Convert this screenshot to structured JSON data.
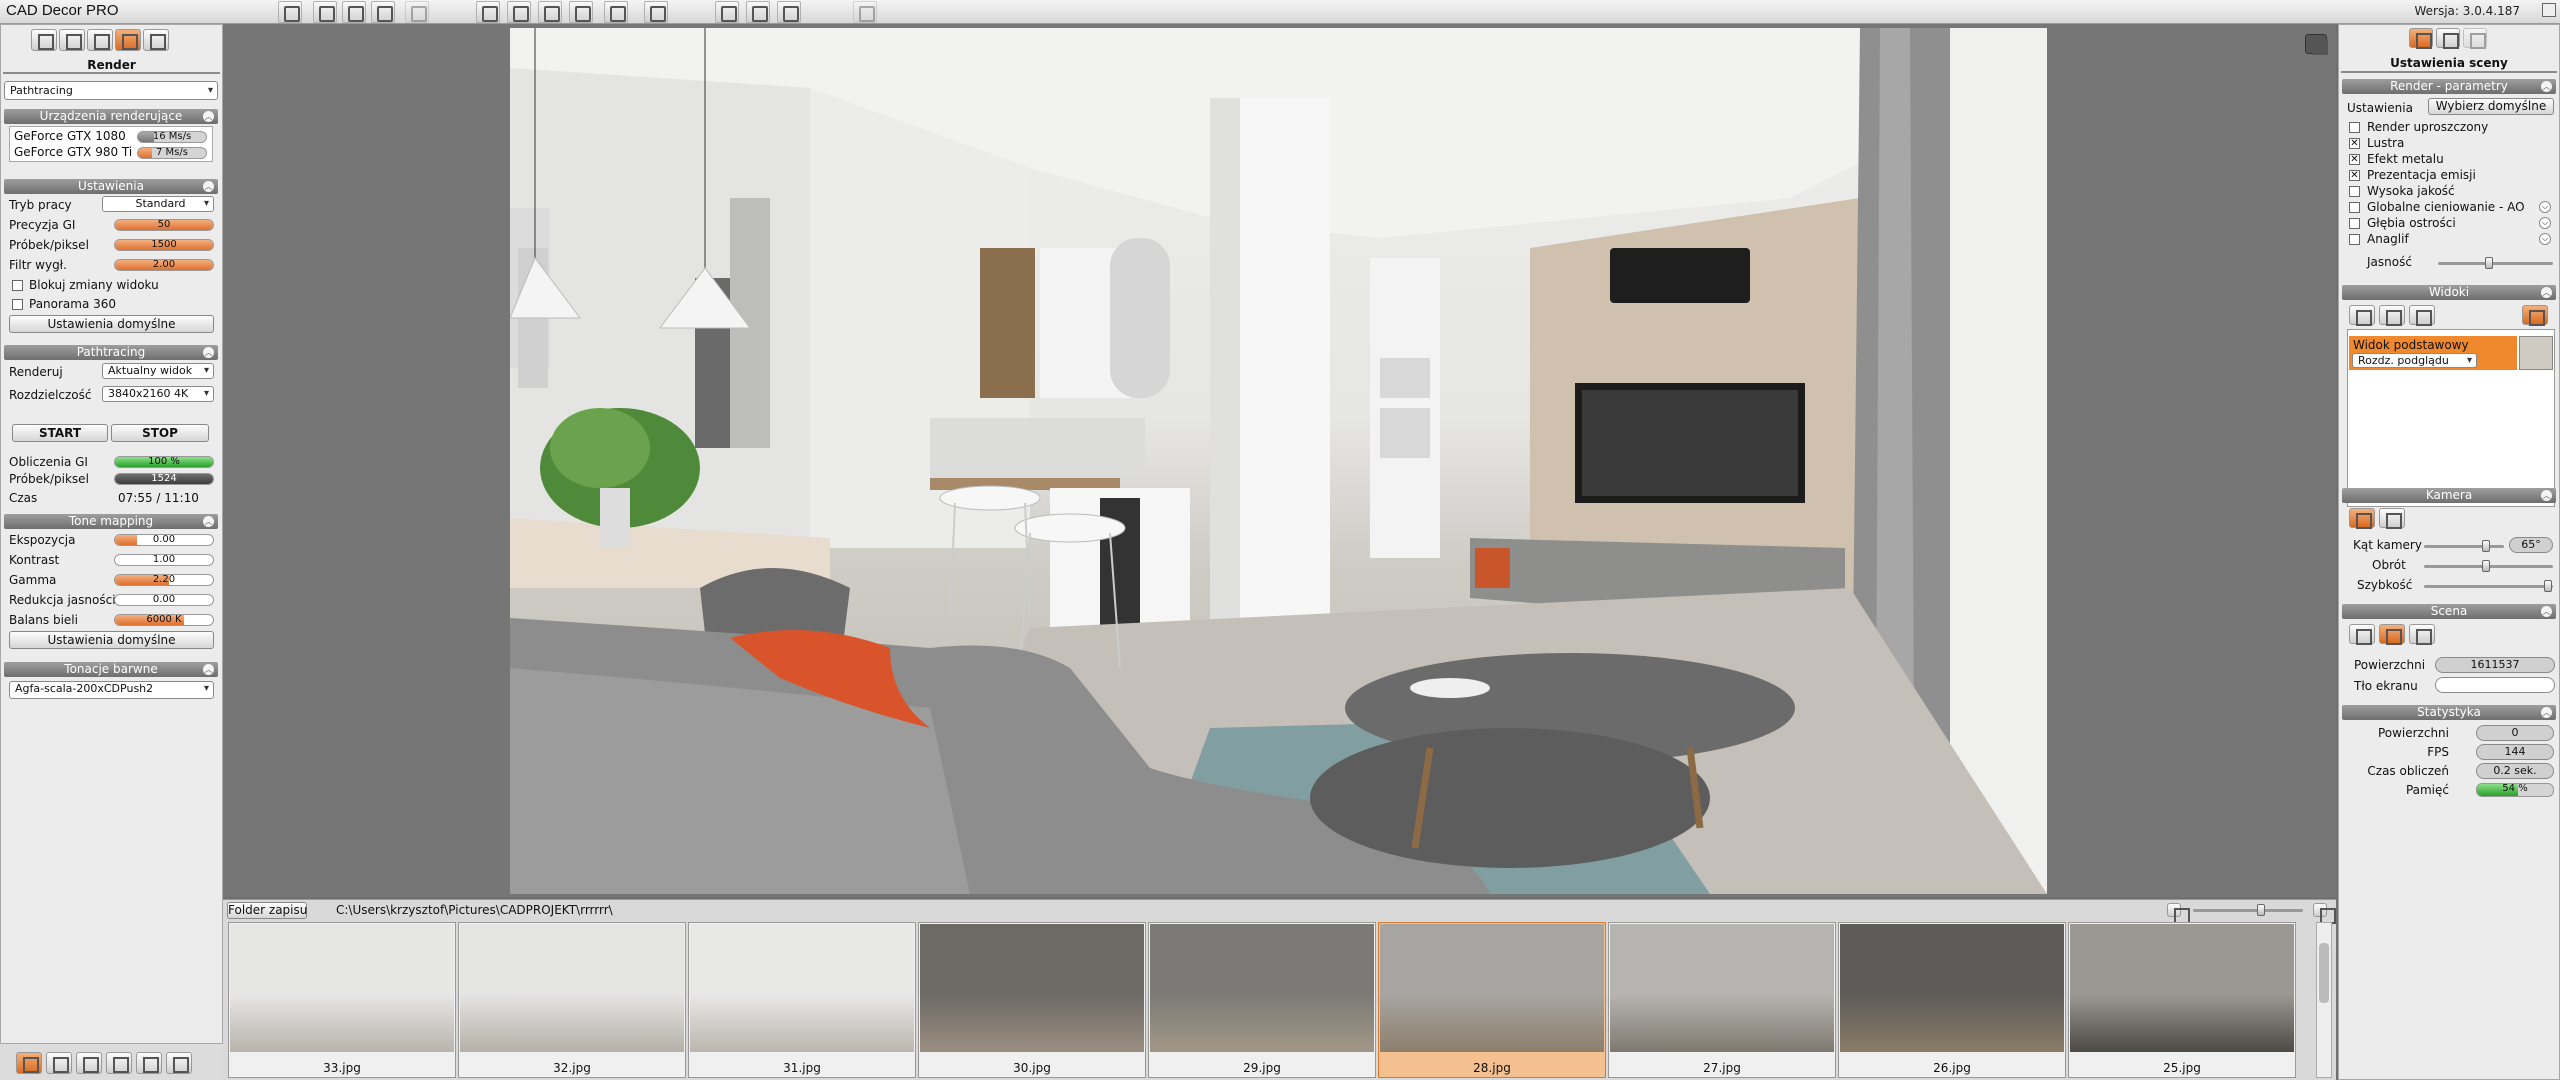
{
  "app": {
    "title": "CAD Decor PRO",
    "version": "Wersja: 3.0.4.187"
  },
  "left": {
    "panel_title": "Render",
    "render_mode": "Pathtracing",
    "devices": {
      "header": "Urządzenia renderujące",
      "items": [
        {
          "name": "GeForce GTX 1080",
          "value": "16 Ms/s"
        },
        {
          "name": "GeForce GTX 980 Ti",
          "value": "7 Ms/s"
        }
      ]
    },
    "settings": {
      "header": "Ustawienia",
      "work_mode_label": "Tryb pracy",
      "work_mode": "Standard",
      "gi_precision_label": "Precyzja GI",
      "gi_precision": "50",
      "samples_label": "Próbek/piksel",
      "samples": "1500",
      "filter_label": "Filtr wygł.",
      "filter": "2.00",
      "lock_label": "Blokuj zmiany widoku",
      "pano_label": "Panorama 360",
      "defaults_btn": "Ustawienia domyślne"
    },
    "pathtracing": {
      "header": "Pathtracing",
      "render_label": "Renderuj",
      "render_value": "Aktualny widok",
      "res_label": "Rozdzielczość",
      "res_value": "3840x2160 4K",
      "start": "START",
      "stop": "STOP",
      "gi_calc_label": "Obliczenia GI",
      "gi_calc": "100 %",
      "gi_calc_fraction": 1.0,
      "samples_label": "Próbek/piksel",
      "samples": "1524",
      "samples_fraction": 1.0,
      "time_label": "Czas",
      "time": "07:55 / 11:10"
    },
    "tone": {
      "header": "Tone mapping",
      "exposure_label": "Ekspozycja",
      "exposure": "0.00",
      "contrast_label": "Kontrast",
      "contrast": "1.00",
      "gamma_label": "Gamma",
      "gamma": "2.20",
      "brightness_label": "Redukcja jasności",
      "brightness": "0.00",
      "wb_label": "Balans bieli",
      "wb": "6000 K",
      "defaults_btn": "Ustawienia domyślne"
    },
    "color": {
      "header": "Tonacje barwne",
      "value": "Agfa-scala-200xCDPush2"
    }
  },
  "right": {
    "panel_title": "Ustawienia sceny",
    "render_params": {
      "header": "Render - parametry",
      "tab_settings": "Ustawienia",
      "tab_defaults": "Wybierz domyślne",
      "options": [
        {
          "label": "Render uproszczony",
          "checked": false
        },
        {
          "label": "Lustra",
          "checked": true
        },
        {
          "label": "Efekt metalu",
          "checked": true
        },
        {
          "label": "Prezentacja emisji",
          "checked": true
        },
        {
          "label": "Wysoka jakość",
          "checked": false
        },
        {
          "label": "Globalne cieniowanie - AO",
          "checked": false
        },
        {
          "label": "Głębia ostrości",
          "checked": false
        },
        {
          "label": "Anaglif",
          "checked": false
        }
      ],
      "brightness_label": "Jasność"
    },
    "views": {
      "header": "Widoki",
      "view_name": "Widok podstawowy",
      "view_select": "Rozdz. podglądu"
    },
    "camera": {
      "header": "Kamera",
      "angle_label": "Kąt kamery",
      "angle": "65°",
      "rotation_label": "Obrót",
      "speed_label": "Szybkość"
    },
    "scene": {
      "header": "Scena",
      "surfaces_label": "Powierzchni",
      "surfaces": "1611537",
      "bg_label": "Tło ekranu"
    },
    "stats": {
      "header": "Statystyka",
      "surfaces_label": "Powierzchni",
      "surfaces": "0",
      "fps_label": "FPS",
      "fps": "144",
      "calc_label": "Czas obliczeń",
      "calc": "0.2 sek.",
      "mem_label": "Pamięć",
      "mem": "54 %",
      "mem_fraction": 0.54
    }
  },
  "bottom": {
    "folder_btn": "Folder zapisu",
    "path": "C:\\Users\\krzysztof\\Pictures\\CADPROJEKT\\rrrrrr\\",
    "thumbs": [
      "33.jpg",
      "32.jpg",
      "31.jpg",
      "30.jpg",
      "29.jpg",
      "28.jpg",
      "27.jpg",
      "26.jpg",
      "25.jpg"
    ],
    "selected": "28.jpg"
  }
}
